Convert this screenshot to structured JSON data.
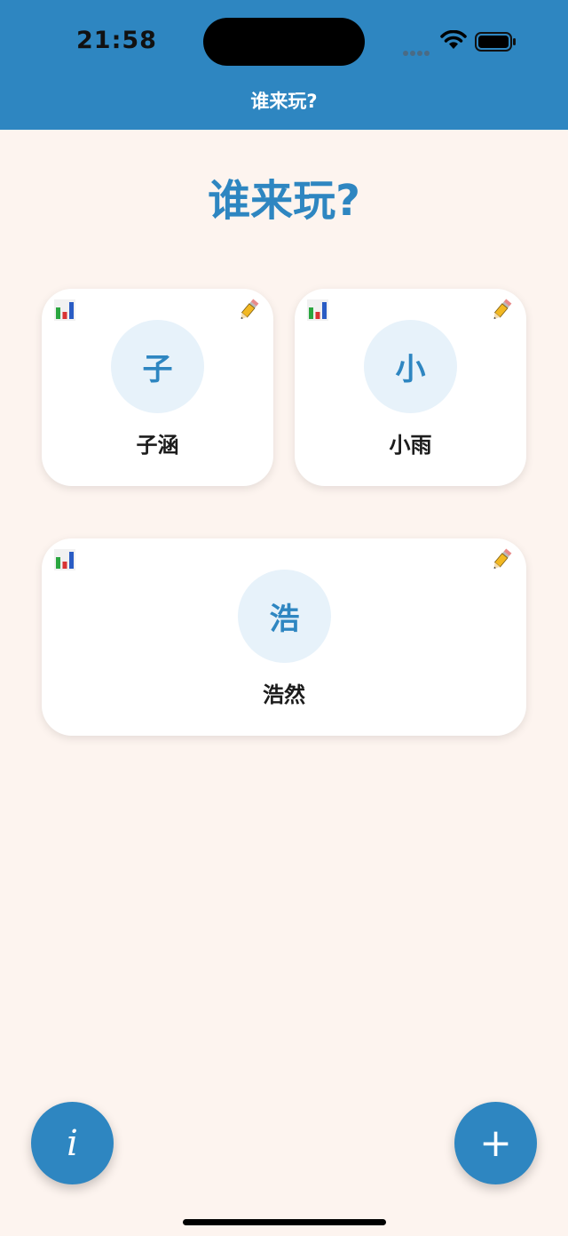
{
  "status_bar": {
    "time": "21:58"
  },
  "nav": {
    "title": "谁来玩?"
  },
  "page": {
    "title": "谁来玩?"
  },
  "players": [
    {
      "initial": "子",
      "name": "子涵"
    },
    {
      "initial": "小",
      "name": "小雨"
    },
    {
      "initial": "浩",
      "name": "浩然"
    }
  ],
  "icons": {
    "stats": "bar-chart-icon",
    "edit": "pencil-icon",
    "info": "i",
    "add": "+"
  },
  "colors": {
    "primary": "#2e86c1",
    "background": "#fdf4ef",
    "avatar_bg": "#e7f2fa",
    "card_bg": "#ffffff"
  }
}
